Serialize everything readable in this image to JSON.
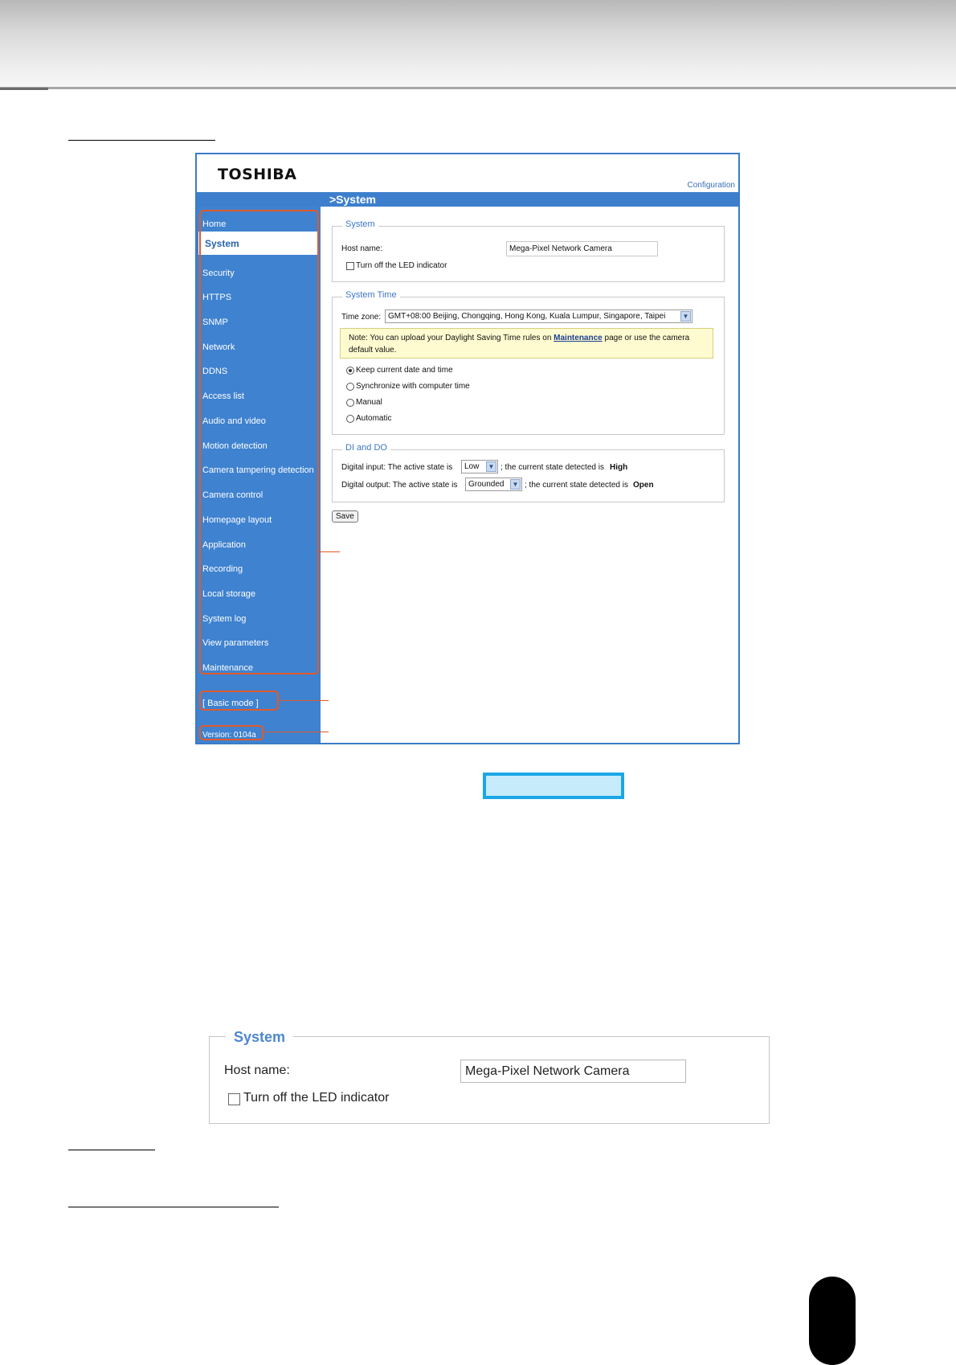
{
  "screen": {
    "logo": "TOSHIBA",
    "config_link": "Configuration",
    "page_title": ">System",
    "sidebar": {
      "active": "System",
      "items": [
        "Home",
        "Security",
        "HTTPS",
        "SNMP",
        "Network",
        "DDNS",
        "Access list",
        "Audio and video",
        "Motion detection",
        "Camera tampering detection",
        "Camera control",
        "Homepage layout",
        "Application",
        "Recording",
        "Local storage",
        "System log",
        "View parameters",
        "Maintenance"
      ],
      "basic_mode": "[ Basic mode ]",
      "version": "Version: 0104a"
    },
    "system": {
      "legend": "System",
      "host_label": "Host name:",
      "host_value": "Mega-Pixel Network Camera",
      "led_label": "Turn off the LED indicator"
    },
    "system_time": {
      "legend": "System Time",
      "timezone_label": "Time zone:",
      "timezone_value": "GMT+08:00 Beijing, Chongqing, Hong Kong, Kuala Lumpur, Singapore, Taipei",
      "note_prefix": "Note: You can upload your Daylight Saving Time rules on ",
      "note_link": "Maintenance",
      "note_suffix": " page or use the camera",
      "note_line2": "default value.",
      "options": [
        "Keep current date and time",
        "Synchronize with computer time",
        "Manual",
        "Automatic"
      ],
      "selected": "Keep current date and time"
    },
    "dido": {
      "legend": "DI and DO",
      "di_prefix": "Digital input: The active state is",
      "di_value": "Low",
      "di_mid": "; the current state detected is",
      "di_state": "High",
      "do_prefix": "Digital output: The active state is",
      "do_value": "Grounded",
      "do_mid": "; the current state detected is",
      "do_state": "Open"
    },
    "save_label": "Save"
  },
  "enlarged": {
    "legend": "System",
    "host_label": "Host name:",
    "host_value": "Mega-Pixel Network Camera",
    "led_label": "Turn off the LED indicator"
  },
  "colors": {
    "sidebar_blue": "#3f82d0",
    "annotation_orange": "#e05a2a",
    "highlight_cyan": "#1aa7e6"
  }
}
